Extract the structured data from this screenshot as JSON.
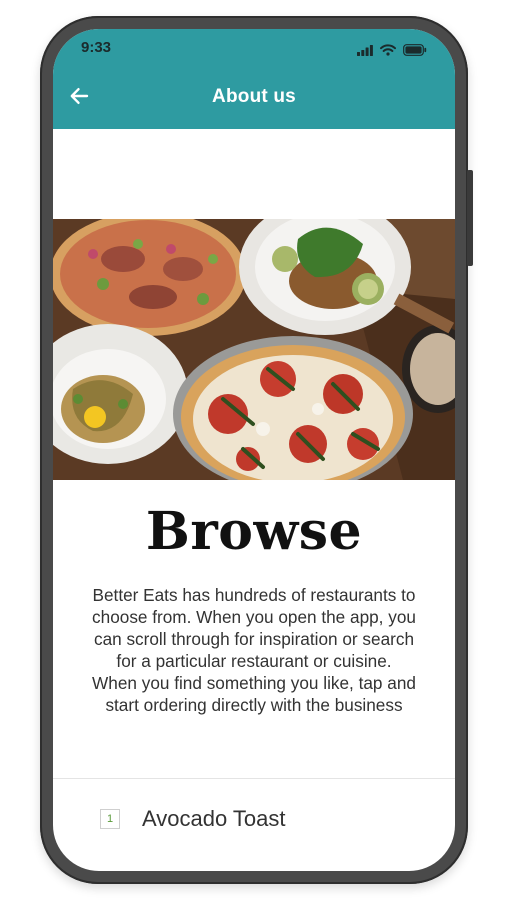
{
  "status_bar": {
    "time": "9:33",
    "icons": [
      "signal-icon",
      "wifi-icon",
      "battery-icon"
    ]
  },
  "app_bar": {
    "title": "About us",
    "back_icon": "arrow-left-icon",
    "background_color": "#2e9ba1"
  },
  "hero": {
    "image": "food-spread-photo"
  },
  "content": {
    "heading": "Browse",
    "body_lines": [
      "Better Eats has hundreds of restaurants to",
      "choose from. When you open the app, you",
      "can scroll through for inspiration or search",
      "for a particular restaurant or cuisine.",
      "When you find something you like, tap and",
      "start ordering directly with the business"
    ]
  },
  "list": {
    "items": [
      {
        "number": "1",
        "label": "Avocado Toast"
      }
    ]
  }
}
